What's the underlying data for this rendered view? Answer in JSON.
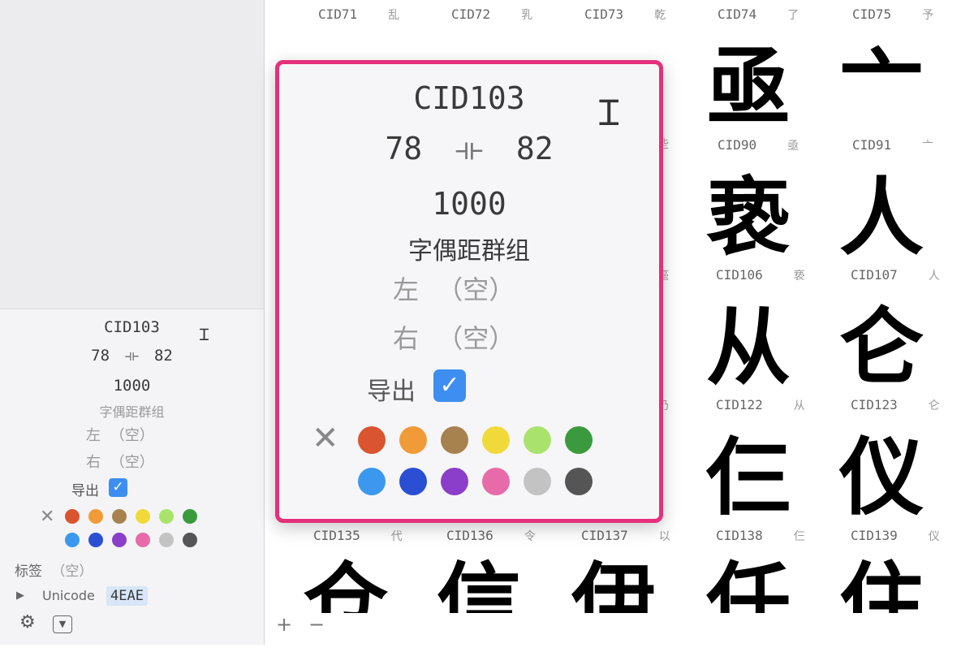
{
  "sidebar": {
    "glyph_name": "CID103",
    "left_sidebearing": "78",
    "right_sidebearing": "82",
    "width": "1000",
    "kerning_group_label": "字偶距群组",
    "left_label": "左",
    "left_value": "（空）",
    "right_label": "右",
    "right_value": "（空）",
    "export_label": "导出",
    "export_checked": true,
    "tags_label": "标签",
    "tags_value": "（空）",
    "unicode_label": "Unicode",
    "unicode_value": "4EAE"
  },
  "popup": {
    "glyph_name": "CID103",
    "left_sidebearing": "78",
    "right_sidebearing": "82",
    "width": "1000",
    "kerning_group_label": "字偶距群组",
    "left_label": "左",
    "left_value": "（空）",
    "right_label": "右",
    "right_value": "（空）",
    "export_label": "导出",
    "export_checked": true
  },
  "colors": {
    "accent": "#e5307a",
    "label_colors_row1": [
      "#d9542f",
      "#f19b38",
      "#a7824f",
      "#f2d93a",
      "#a9e36c",
      "#3b9a3d"
    ],
    "label_colors_row2": [
      "#3c98ee",
      "#2a4fd3",
      "#8a3ec9",
      "#e66ba8",
      "#c3c3c3",
      "#555555"
    ]
  },
  "grid": {
    "captions": [
      {
        "label": "CID71",
        "char": "乱"
      },
      {
        "label": "CID72",
        "char": "乳"
      },
      {
        "label": "CID73",
        "char": "乾"
      },
      {
        "label": "CID74",
        "char": "了"
      },
      {
        "label": "CID75",
        "char": "予"
      },
      {
        "label": "CID90",
        "char": "亟"
      },
      {
        "label": "CID91",
        "char": "亠"
      },
      {
        "label": "CID106",
        "char": "亵"
      },
      {
        "label": "CID107",
        "char": "人"
      },
      {
        "label": "CID122",
        "char": "从"
      },
      {
        "label": "CID123",
        "char": "仑"
      },
      {
        "label": "CID135",
        "char": "代"
      },
      {
        "label": "CID136",
        "char": "令"
      },
      {
        "label": "CID137",
        "char": "以"
      },
      {
        "label": "CID138",
        "char": "仨"
      },
      {
        "label": "CID139",
        "char": "仪"
      }
    ],
    "partial_chars": [
      "些",
      "毫",
      "仍"
    ],
    "glyphs": [
      "亟",
      "亠",
      "亵",
      "人",
      "从",
      "仑",
      "仨",
      "仪",
      "仓",
      "信",
      "伊",
      "任",
      "住"
    ]
  },
  "bottom": {
    "add": "+",
    "remove": "−"
  }
}
